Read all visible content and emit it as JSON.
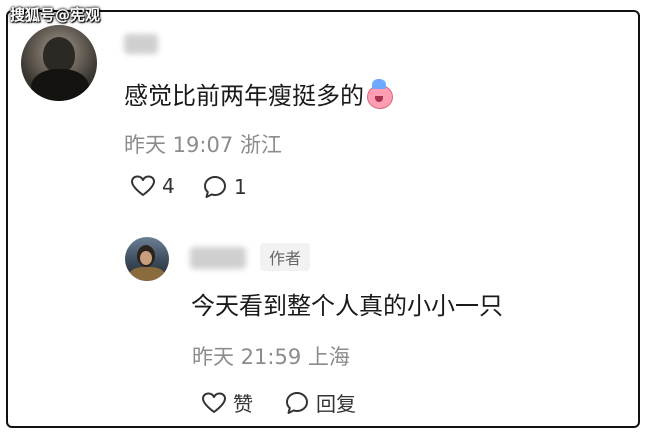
{
  "watermark": "搜狐号@宪观",
  "comment": {
    "text": "感觉比前两年瘦挺多的",
    "emoji": "crying-face-emoji",
    "time": "昨天 19:07",
    "location": "浙江",
    "likes": "4",
    "replies": "1"
  },
  "reply": {
    "author_badge": "作者",
    "text": "今天看到整个人真的小小一只",
    "time": "昨天 21:59",
    "location": "上海",
    "like_label": "赞",
    "reply_label": "回复"
  },
  "colors": {
    "text": "#1a1a1a",
    "meta": "#8c8c8c",
    "badge_bg": "#f2f2f2",
    "frame": "#111111"
  }
}
